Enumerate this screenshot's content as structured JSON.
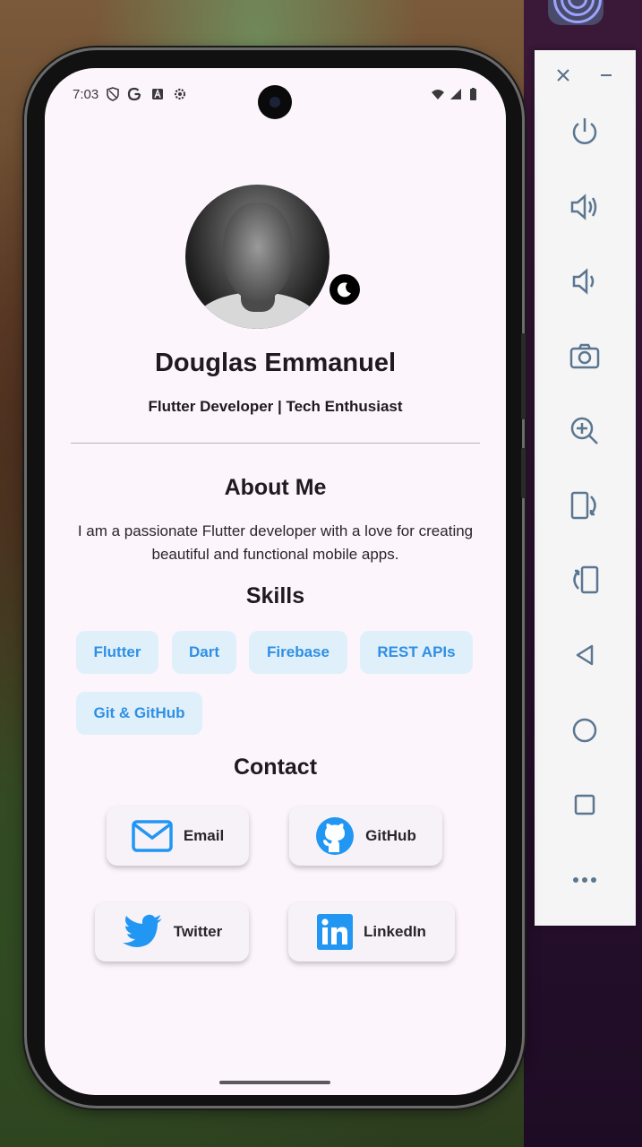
{
  "status_bar": {
    "time": "7:03",
    "left_icons": [
      "shield-icon",
      "google-icon",
      "font-icon",
      "settings-icon"
    ],
    "right_icons": [
      "wifi-icon",
      "signal-icon",
      "battery-icon"
    ]
  },
  "profile": {
    "name": "Douglas Emmanuel",
    "tagline": "Flutter Developer | Tech Enthusiast",
    "theme_toggle_icon": "moon-icon"
  },
  "about": {
    "heading": "About Me",
    "text": "I am a passionate Flutter developer with a love for creating beautiful and functional mobile apps."
  },
  "skills": {
    "heading": "Skills",
    "items": [
      "Flutter",
      "Dart",
      "Firebase",
      "REST APIs",
      "Git & GitHub"
    ]
  },
  "contact": {
    "heading": "Contact",
    "buttons": [
      {
        "label": "Email",
        "icon": "email-icon"
      },
      {
        "label": "GitHub",
        "icon": "github-icon"
      },
      {
        "label": "Twitter",
        "icon": "twitter-icon"
      },
      {
        "label": "LinkedIn",
        "icon": "linkedin-icon"
      }
    ]
  },
  "emulator_toolbar": {
    "items": [
      "close-icon",
      "minimize-icon",
      "power-icon",
      "volume-up-icon",
      "volume-down-icon",
      "camera-icon",
      "zoom-icon",
      "rotate-left-icon",
      "rotate-right-icon",
      "back-icon",
      "home-icon",
      "overview-icon",
      "more-icon"
    ]
  },
  "colors": {
    "background": "#fdf5fc",
    "chip_bg": "#dff0fb",
    "chip_text": "#2f8fe4",
    "accent_blue": "#2196f3"
  }
}
